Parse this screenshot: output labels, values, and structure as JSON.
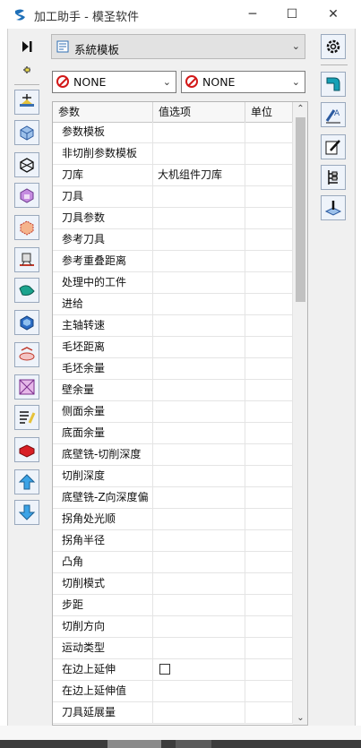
{
  "window": {
    "title": "加工助手 - 模圣软件",
    "minimize": "─",
    "maximize": "☐",
    "close": "✕"
  },
  "template_select": {
    "value": "系統模板"
  },
  "combo_left": {
    "value": "NONE"
  },
  "combo_right": {
    "value": "NONE"
  },
  "grid": {
    "headers": [
      "参数",
      "值选项",
      "单位"
    ],
    "rows": [
      {
        "param": "参数模板",
        "value": "",
        "unit": ""
      },
      {
        "param": "非切削参数模板",
        "value": "",
        "unit": ""
      },
      {
        "param": "刀库",
        "value": "大机组件刀库",
        "unit": ""
      },
      {
        "param": "刀具",
        "value": "",
        "unit": ""
      },
      {
        "param": "刀具参数",
        "value": "",
        "unit": ""
      },
      {
        "param": "参考刀具",
        "value": "",
        "unit": ""
      },
      {
        "param": "参考重叠距离",
        "value": "",
        "unit": ""
      },
      {
        "param": "处理中的工件",
        "value": "",
        "unit": ""
      },
      {
        "param": "进给",
        "value": "",
        "unit": ""
      },
      {
        "param": "主轴转速",
        "value": "",
        "unit": ""
      },
      {
        "param": "毛坯距离",
        "value": "",
        "unit": ""
      },
      {
        "param": "毛坯余量",
        "value": "",
        "unit": ""
      },
      {
        "param": "壁余量",
        "value": "",
        "unit": ""
      },
      {
        "param": "侧面余量",
        "value": "",
        "unit": ""
      },
      {
        "param": "底面余量",
        "value": "",
        "unit": ""
      },
      {
        "param": "底壁铣-切削深度",
        "value": "",
        "unit": ""
      },
      {
        "param": "切削深度",
        "value": "",
        "unit": ""
      },
      {
        "param": "底壁铣-Z向深度偏",
        "value": "",
        "unit": ""
      },
      {
        "param": "拐角处光顺",
        "value": "",
        "unit": ""
      },
      {
        "param": "拐角半径",
        "value": "",
        "unit": ""
      },
      {
        "param": "凸角",
        "value": "",
        "unit": ""
      },
      {
        "param": "切削模式",
        "value": "",
        "unit": ""
      },
      {
        "param": "步距",
        "value": "",
        "unit": ""
      },
      {
        "param": "切削方向",
        "value": "",
        "unit": ""
      },
      {
        "param": "运动类型",
        "value": "",
        "unit": ""
      },
      {
        "param": "在边上延伸",
        "value": "",
        "unit": "",
        "checkbox": true
      },
      {
        "param": "在边上延伸值",
        "value": "",
        "unit": ""
      },
      {
        "param": "刀具延展量",
        "value": "",
        "unit": ""
      }
    ]
  },
  "left_toolbar": [
    "skip-to-end-icon",
    "pin-icon",
    "operation-icon",
    "block-icon",
    "wire-box-icon",
    "part-icon",
    "boundary-box-icon",
    "cad-model-icon",
    "green-solid-icon",
    "blue-shell-icon",
    "toolpath-icon",
    "area-icon",
    "edit-list-icon",
    "red-stock-icon",
    "arrow-up-icon",
    "arrow-down-icon"
  ],
  "right_toolbar": [
    "gear-icon",
    "pipe-icon",
    "rename-icon",
    "edit-icon",
    "tool-layout-icon",
    "tool-drill-icon"
  ]
}
